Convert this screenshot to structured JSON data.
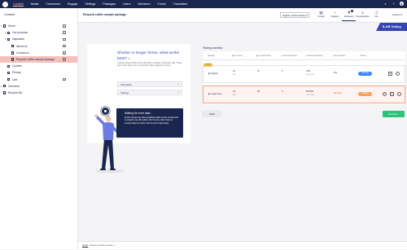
{
  "topnav": {
    "items": [
      "Content",
      "Media",
      "Commerce",
      "Engage",
      "Settings",
      "Packages",
      "Users",
      "Members",
      "Forms",
      "Translation"
    ],
    "active": "Content",
    "icons": [
      "search-icon",
      "help-icon",
      "user-icon"
    ]
  },
  "sidebar": {
    "title": "Content",
    "tree": [
      {
        "label": "Home",
        "level": 0,
        "icon": "home-icon",
        "expanded": true
      },
      {
        "label": "Our products",
        "level": 1,
        "icon": "folder-icon",
        "expanded": false
      },
      {
        "label": "Inspiration",
        "level": 1,
        "icon": "folder-icon",
        "expanded": true
      },
      {
        "label": "About Us",
        "level": 2,
        "icon": "page-icon"
      },
      {
        "label": "Contact us",
        "level": 2,
        "icon": "page-icon"
      },
      {
        "label": "Request coffee sample package",
        "level": 2,
        "icon": "page-icon",
        "selected": true
      },
      {
        "label": "Cookies",
        "level": 1,
        "icon": "page-icon"
      },
      {
        "label": "Privacy",
        "level": 1,
        "icon": "page-icon"
      },
      {
        "label": "Cart",
        "level": 1,
        "icon": "cart-icon"
      },
      {
        "label": "Checkout",
        "level": 0,
        "icon": "page-icon",
        "expanded": false
      },
      {
        "label": "Recycle Bin",
        "level": 0,
        "icon": "trash-icon"
      }
    ]
  },
  "header": {
    "name_value": "Request coffee sample package",
    "language": "English (United States)",
    "apps": [
      {
        "label": "Content",
        "icon": "▤"
      },
      {
        "label": "Analytics",
        "icon": "◔"
      },
      {
        "label": "A/B testing",
        "icon": "⚗",
        "badge": "1",
        "active": true
      },
      {
        "label": "Personalization",
        "icon": "☺"
      },
      {
        "label": "Info",
        "icon": "ⓘ"
      }
    ],
    "actions_label": "Actions ▾"
  },
  "ab_button": "A/B Testing",
  "card": {
    "title": "Shorter or longer forms, what works best?",
    "description": "I assume that a shorter form will lead to a higher conversion rate. These forms don't have a lot of conversion killer questions in them.",
    "accordions": [
      "Information",
      "Settings"
    ]
  },
  "bubble": {
    "title": "Waiting for more data...",
    "text": "At the moment we have insufficient data on this running test to support you with advice. Don't worry, when there is enough data the advice will be shown right away!"
  },
  "panel": {
    "title": "Testing overview",
    "columns": [
      "VARIANT",
      "VISITORS",
      "CONVERSIONS",
      "CONVERSION RATE",
      "CONVERSION RANGE",
      "IMPROVEMENT",
      "STATUS"
    ],
    "rows": [
      {
        "tag": "Original",
        "name": "Original",
        "visitors": "13",
        "visitors_sub": "40%",
        "conversions": "27",
        "conv_rate": "4",
        "conv_range": "73%",
        "conv_range_sub": "1.6% - 1.8%",
        "improvement": "0%",
        "status": "Running",
        "status_color": "#3b86f7",
        "winner": false
      },
      {
        "tag": "",
        "name": "Longer form",
        "visitors": "13",
        "visitors_sub": "40%",
        "conversions": "35",
        "conv_rate": "4",
        "conv_range": "58.96%",
        "conv_range_sub": "1.6% - 1.8%",
        "improvement": "Winning",
        "status": "Paused",
        "status_color": "#f5a05f",
        "winner": true
      }
    ]
  },
  "buttons": {
    "back": "Back",
    "next": "Next test"
  },
  "footer": {
    "crumb1": "Home",
    "crumb2": "Request coffee sample p..."
  }
}
